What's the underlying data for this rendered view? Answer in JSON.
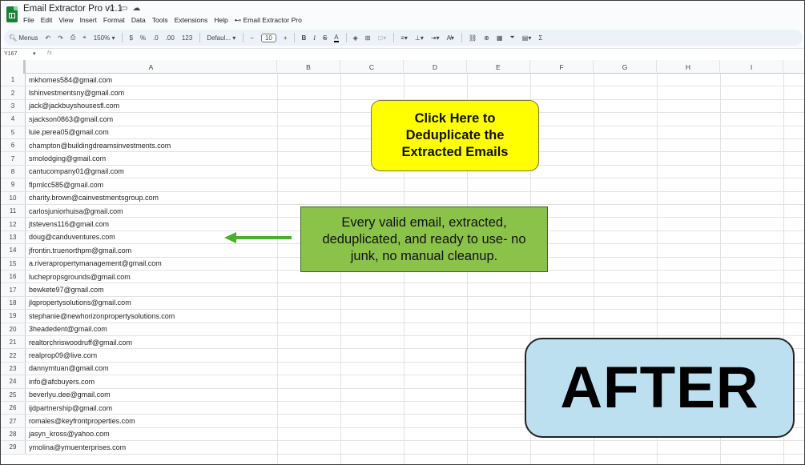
{
  "window": {
    "title": "Email Extractor Pro v1.1"
  },
  "menu": [
    "File",
    "Edit",
    "View",
    "Insert",
    "Format",
    "Data",
    "Tools",
    "Extensions",
    "Help",
    "Email Extractor Pro"
  ],
  "toolbar": {
    "menus_label": "Menus",
    "zoom": "150%",
    "currency": "$",
    "percent": "%",
    "dec_decrease": ".0",
    "dec_increase": ".00",
    "number_format": "123",
    "font": "Defaul...",
    "font_size": "10"
  },
  "formula_bar": {
    "cell_ref": "Y167",
    "fx": "fx"
  },
  "columns": [
    "A",
    "B",
    "C",
    "D",
    "E",
    "F",
    "G",
    "H",
    "I"
  ],
  "rows": [
    {
      "n": "1",
      "email": "mkhomes584@gmail.com"
    },
    {
      "n": "2",
      "email": "lshinvestmentsny@gmail.com"
    },
    {
      "n": "3",
      "email": "jack@jackbuyshousesfl.com"
    },
    {
      "n": "4",
      "email": "sjackson0863@gmail.com"
    },
    {
      "n": "5",
      "email": "luie.perea05@gmail.com"
    },
    {
      "n": "6",
      "email": "champton@buildingdreamsinvestments.com"
    },
    {
      "n": "7",
      "email": "smolodging@gmail.com"
    },
    {
      "n": "8",
      "email": "cantucompany01@gmail.com"
    },
    {
      "n": "9",
      "email": "flpmlcc585@gmail.com"
    },
    {
      "n": "10",
      "email": "charity.brown@cainvestmentsgroup.com"
    },
    {
      "n": "11",
      "email": "carlosjuniorhuisa@gmail.com"
    },
    {
      "n": "12",
      "email": "jtstevens116@gmail.com"
    },
    {
      "n": "13",
      "email": "doug@canduventures.com"
    },
    {
      "n": "14",
      "email": "jfrontin.truenorthpm@gmail.com"
    },
    {
      "n": "15",
      "email": "a.riverapropertymanagement@gmail.com"
    },
    {
      "n": "16",
      "email": "luchepropsgrounds@gmail.com"
    },
    {
      "n": "17",
      "email": "bewkete97@gmail.com"
    },
    {
      "n": "18",
      "email": "jlqpropertysolutions@gmail.com"
    },
    {
      "n": "19",
      "email": "stephanie@newhorizonpropertysolutions.com"
    },
    {
      "n": "20",
      "email": "3headedent@gmail.com"
    },
    {
      "n": "21",
      "email": "realtorchriswoodruff@gmail.com"
    },
    {
      "n": "22",
      "email": "realprop09@live.com"
    },
    {
      "n": "23",
      "email": "dannymtuan@gmail.com"
    },
    {
      "n": "24",
      "email": "info@afcbuyers.com"
    },
    {
      "n": "25",
      "email": "beverlyu.dee@gmail.com"
    },
    {
      "n": "26",
      "email": "ijdpartnership@gmail.com"
    },
    {
      "n": "27",
      "email": "romales@keyfrontproperties.com"
    },
    {
      "n": "28",
      "email": "jasyn_kross@yahoo.com"
    },
    {
      "n": "29",
      "email": "ymolina@ymuenterprises.com"
    }
  ],
  "callouts": {
    "dedupe": "Click Here to Deduplicate the Extracted Emails",
    "info": "Every valid email, extracted, deduplicated, and ready to use- no junk, no manual cleanup.",
    "after": "AFTER"
  },
  "colors": {
    "yellow": "#ffff00",
    "green": "#8bc34a",
    "after_bg": "#bde0f0",
    "arrow": "#4caf2a",
    "sheets_green": "#188038"
  }
}
